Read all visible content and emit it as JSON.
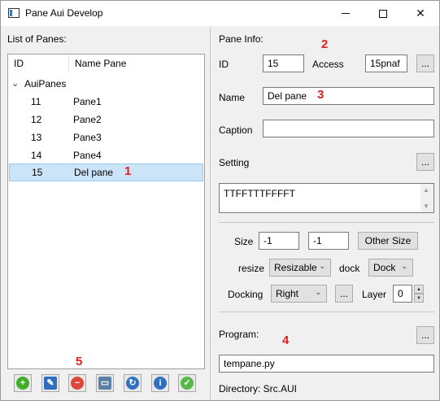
{
  "window": {
    "title": "Pane Aui Develop"
  },
  "left": {
    "heading": "List of Panes:",
    "tree": {
      "columns": [
        "ID",
        "Name Pane"
      ],
      "root_label": "AuiPanes",
      "rows": [
        {
          "id": "11",
          "name": "Pane1",
          "selected": false
        },
        {
          "id": "12",
          "name": "Pane2",
          "selected": false
        },
        {
          "id": "13",
          "name": "Pane3",
          "selected": false
        },
        {
          "id": "14",
          "name": "Pane4",
          "selected": false
        },
        {
          "id": "15",
          "name": "Del pane",
          "selected": true
        }
      ]
    },
    "toolbar_icons": [
      "add-icon",
      "edit-icon",
      "delete-icon",
      "preview-icon",
      "refresh-icon",
      "info-icon",
      "ok-icon"
    ]
  },
  "annotations": {
    "n1": "1",
    "n2": "2",
    "n3": "3",
    "n4": "4",
    "n5": "5"
  },
  "right": {
    "heading": "Pane Info:",
    "id_label": "ID",
    "id_value": "15",
    "access_label": "Access",
    "access_value": "15pnaf",
    "dots": "...",
    "name_label": "Name",
    "name_value": "Del pane",
    "caption_label": "Caption",
    "caption_value": "",
    "setting_label": "Setting",
    "setting_value": "TTFFTTTFFFFT",
    "size_label": "Size",
    "size_w": "-1",
    "size_h": "-1",
    "other_size_button": "Other Size",
    "resize_label": "resize",
    "resize_value": "Resizable",
    "dock_label": "dock",
    "dock_value": "Dock",
    "docking_label": "Docking",
    "docking_value": "Right",
    "layer_label": "Layer",
    "layer_value": "0",
    "program_label": "Program:",
    "program_value": "tempane.py",
    "directory_text": "Directory: Src.AUI"
  },
  "colors": {
    "selection": "#cce4f7",
    "annotation_red": "#e02020",
    "add_green": "#3fae2a",
    "delete_red": "#e0453a",
    "blue": "#2f6fc0",
    "ok_green": "#58b847"
  }
}
